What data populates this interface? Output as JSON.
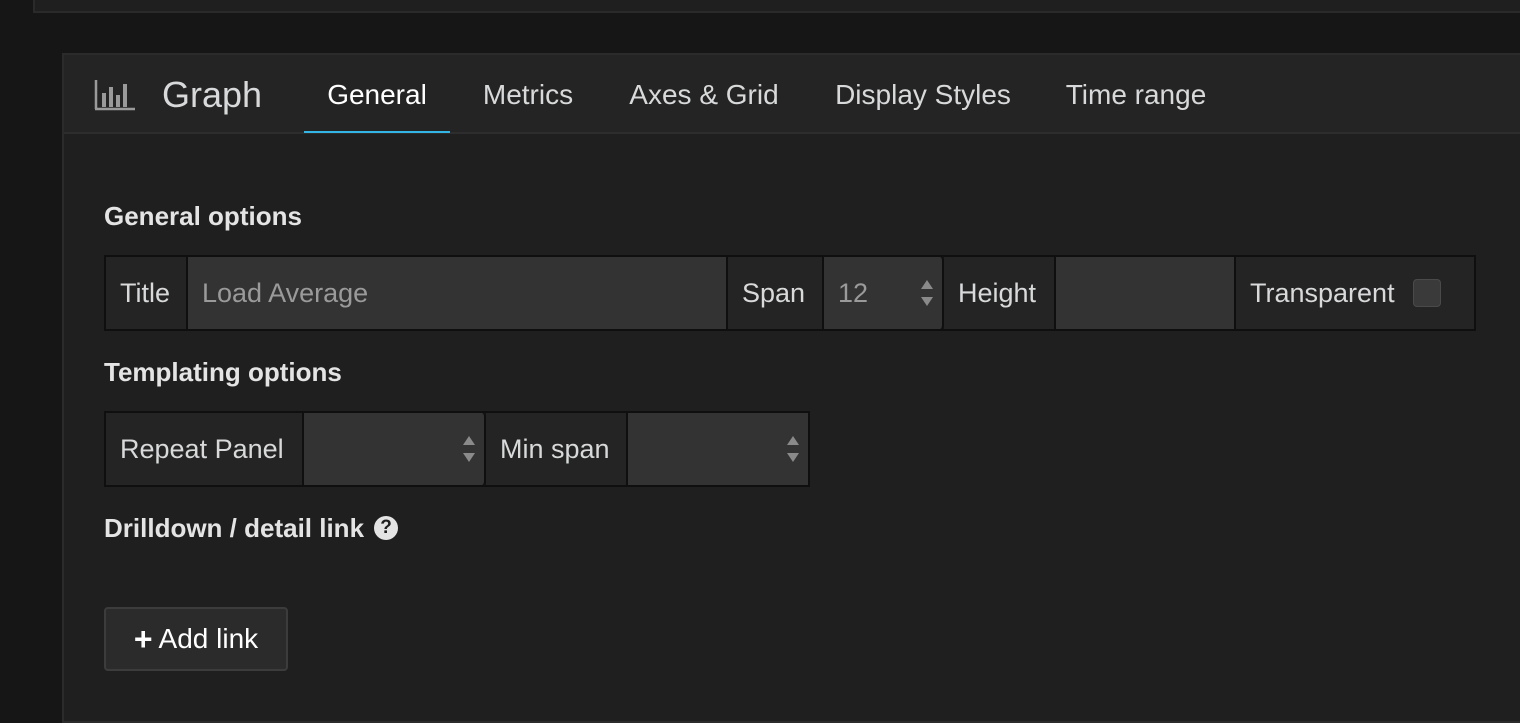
{
  "panel": {
    "type_label": "Graph",
    "tabs": [
      {
        "label": "General",
        "active": true
      },
      {
        "label": "Metrics",
        "active": false
      },
      {
        "label": "Axes & Grid",
        "active": false
      },
      {
        "label": "Display Styles",
        "active": false
      },
      {
        "label": "Time range",
        "active": false
      }
    ]
  },
  "general_options": {
    "heading": "General options",
    "title_label": "Title",
    "title_value": "Load Average",
    "span_label": "Span",
    "span_value": "12",
    "height_label": "Height",
    "height_value": "",
    "transparent_label": "Transparent",
    "transparent_checked": false
  },
  "templating_options": {
    "heading": "Templating options",
    "repeat_panel_label": "Repeat Panel",
    "repeat_panel_value": "",
    "min_span_label": "Min span",
    "min_span_value": ""
  },
  "drilldown": {
    "heading": "Drilldown / detail link",
    "help_glyph": "?",
    "add_link_label": "Add link",
    "plus_glyph": "+"
  },
  "colors": {
    "accent": "#33b5e5",
    "panel_bg": "#1f1f1f",
    "input_bg": "#333333"
  },
  "icons": {
    "panel_type": "bar-chart-icon",
    "help": "question-circle-icon",
    "add": "plus-icon"
  }
}
